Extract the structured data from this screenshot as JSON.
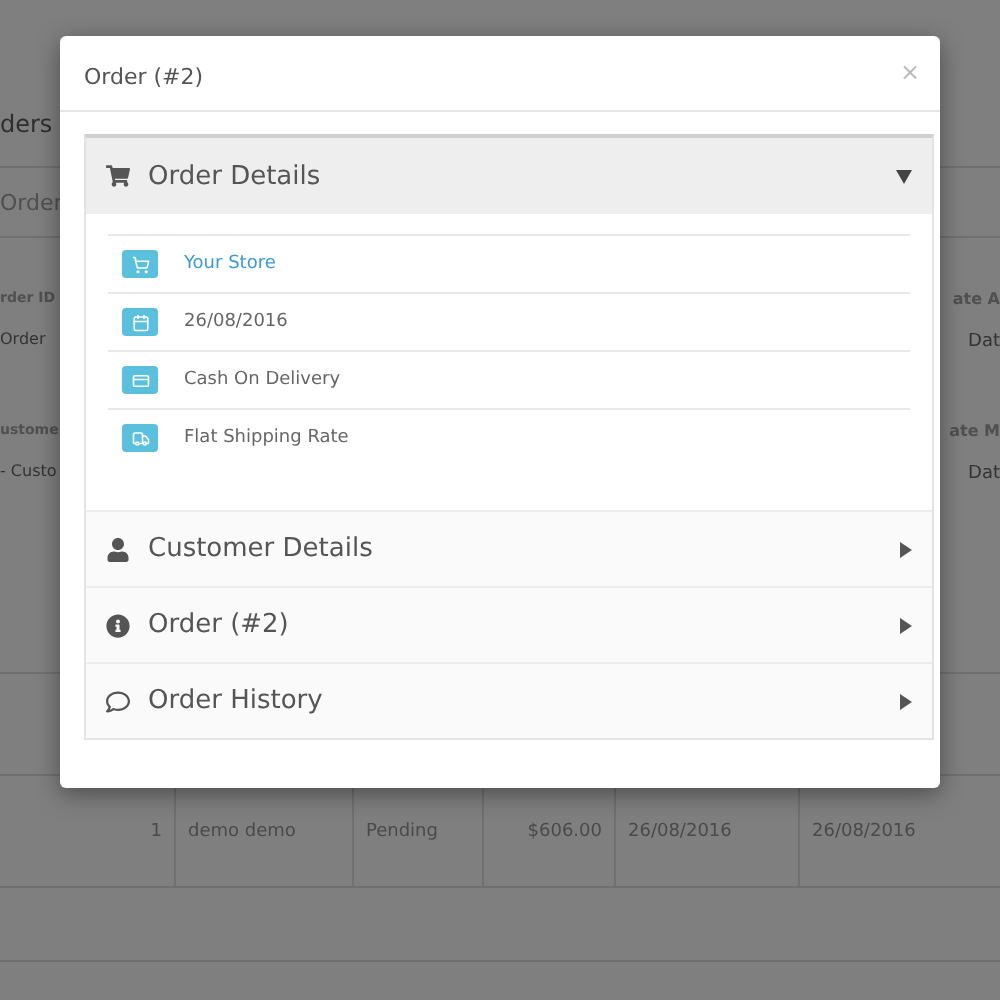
{
  "page": {
    "heading": "ders",
    "panel_title": "Order",
    "filters": [
      {
        "label": "rder ID",
        "placeholder": "Order",
        "right_label": "ate A",
        "right_placeholder": "Dat"
      },
      {
        "label": "ustome",
        "placeholder": "- Custo",
        "right_label": "ate M",
        "right_placeholder": "Dat"
      }
    ],
    "table": {
      "rows": [
        [
          "1",
          "demo demo",
          "Pending",
          "$606.00",
          "26/08/2016",
          "26/08/2016"
        ]
      ]
    }
  },
  "modal": {
    "title": "Order (#2)",
    "close": "×",
    "panels": [
      {
        "title": "Order Details",
        "expanded": true,
        "items": [
          {
            "text": "Your Store",
            "link": true
          },
          {
            "text": "26/08/2016",
            "link": false
          },
          {
            "text": "Cash On Delivery",
            "link": false
          },
          {
            "text": "Flat Shipping Rate",
            "link": false
          }
        ]
      },
      {
        "title": "Customer Details",
        "expanded": false
      },
      {
        "title": "Order (#2)",
        "expanded": false
      },
      {
        "title": "Order History",
        "expanded": false
      }
    ]
  }
}
